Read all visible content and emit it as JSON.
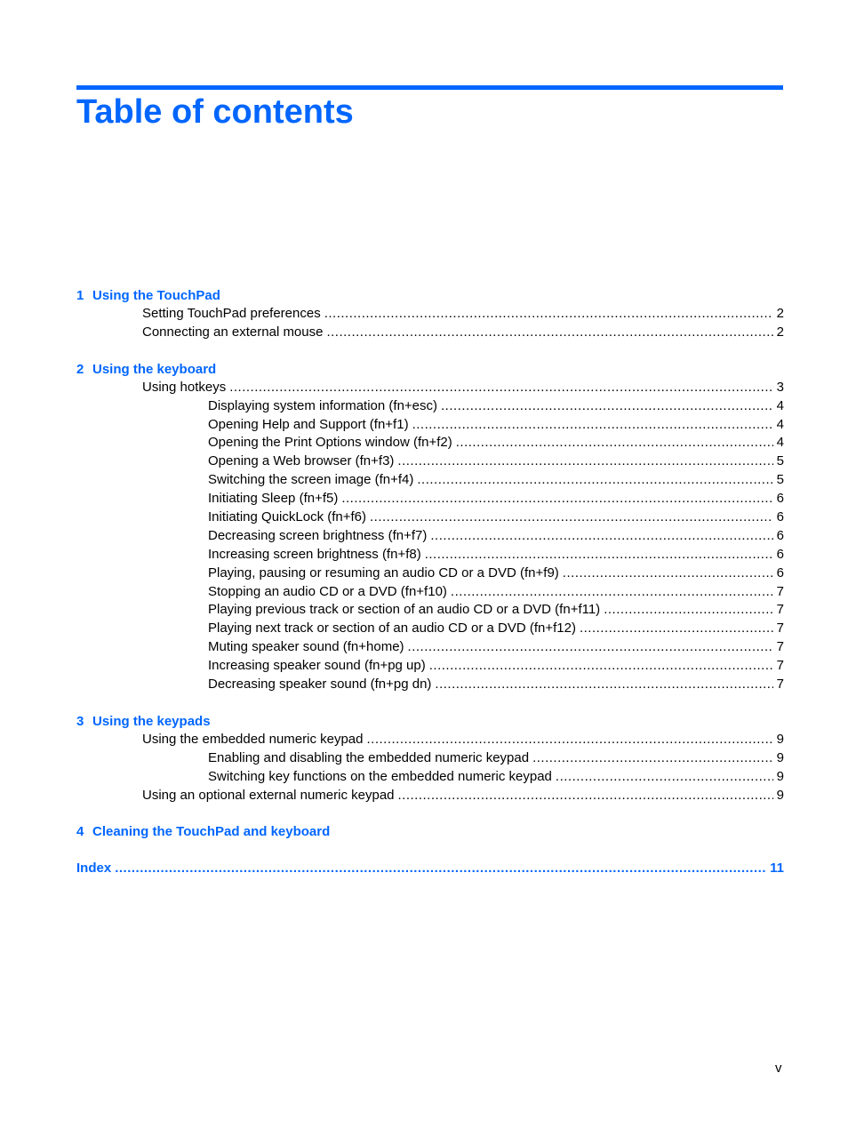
{
  "title": "Table of contents",
  "chapters": [
    {
      "number": "1",
      "title": "Using the TouchPad",
      "entries": [
        {
          "level": 1,
          "label": "Setting TouchPad preferences",
          "page": "2"
        },
        {
          "level": 1,
          "label": "Connecting an external mouse",
          "page": "2"
        }
      ]
    },
    {
      "number": "2",
      "title": "Using the keyboard",
      "entries": [
        {
          "level": 1,
          "label": "Using hotkeys",
          "page": "3"
        },
        {
          "level": 2,
          "label": "Displaying system information (fn+esc)",
          "page": "4"
        },
        {
          "level": 2,
          "label": "Opening Help and Support (fn+f1)",
          "page": "4"
        },
        {
          "level": 2,
          "label": "Opening the Print Options window (fn+f2)",
          "page": "4"
        },
        {
          "level": 2,
          "label": "Opening a Web browser (fn+f3)",
          "page": "5"
        },
        {
          "level": 2,
          "label": "Switching the screen image (fn+f4)",
          "page": "5"
        },
        {
          "level": 2,
          "label": "Initiating Sleep (fn+f5)",
          "page": "6"
        },
        {
          "level": 2,
          "label": "Initiating QuickLock (fn+f6)",
          "page": "6"
        },
        {
          "level": 2,
          "label": "Decreasing screen brightness (fn+f7)",
          "page": "6"
        },
        {
          "level": 2,
          "label": "Increasing screen brightness (fn+f8)",
          "page": "6"
        },
        {
          "level": 2,
          "label": "Playing, pausing or resuming an audio CD or a DVD (fn+f9)",
          "page": "6"
        },
        {
          "level": 2,
          "label": "Stopping an audio CD or a DVD (fn+f10)",
          "page": "7"
        },
        {
          "level": 2,
          "label": "Playing previous track or section of an audio CD or a DVD (fn+f11)",
          "page": "7"
        },
        {
          "level": 2,
          "label": "Playing next track or section of an audio CD or a DVD (fn+f12)",
          "page": "7"
        },
        {
          "level": 2,
          "label": "Muting speaker sound (fn+home)",
          "page": "7"
        },
        {
          "level": 2,
          "label": "Increasing speaker sound (fn+pg up)",
          "page": "7"
        },
        {
          "level": 2,
          "label": "Decreasing speaker sound (fn+pg dn)",
          "page": "7"
        }
      ]
    },
    {
      "number": "3",
      "title": "Using the keypads",
      "entries": [
        {
          "level": 1,
          "label": "Using the embedded numeric keypad",
          "page": "9"
        },
        {
          "level": 2,
          "label": "Enabling and disabling the embedded numeric keypad",
          "page": "9"
        },
        {
          "level": 2,
          "label": "Switching key functions on the embedded numeric keypad",
          "page": "9"
        },
        {
          "level": 1,
          "label": "Using an optional external numeric keypad",
          "page": "9"
        }
      ]
    },
    {
      "number": "4",
      "title": "Cleaning the TouchPad and keyboard",
      "entries": []
    }
  ],
  "index": {
    "label": "Index",
    "page": "11"
  },
  "folio": "v",
  "colors": {
    "accent": "#0066ff",
    "text": "#000000"
  }
}
